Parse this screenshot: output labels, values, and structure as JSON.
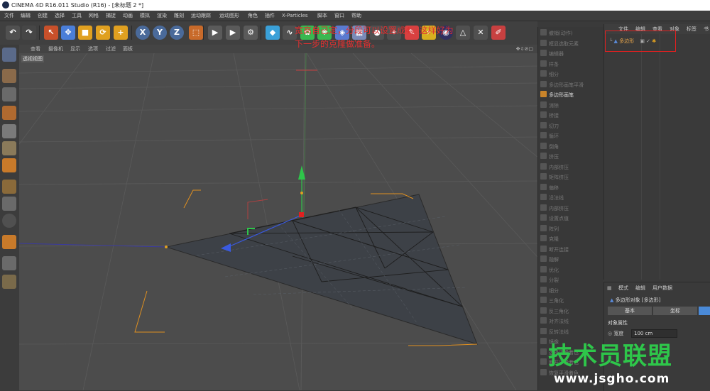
{
  "window": {
    "title": "CINEMA 4D R16.011 Studio (R16) - [未标题 2 *]"
  },
  "menu": [
    "文件",
    "编辑",
    "创建",
    "选择",
    "工具",
    "网格",
    "捕捉",
    "动画",
    "模拟",
    "渲染",
    "雕刻",
    "运动跟踪",
    "运动图形",
    "角色",
    "插件",
    "X-Particles",
    "脚本",
    "窗口",
    "帮助"
  ],
  "toolbar": {
    "items": [
      {
        "icon": "undo-icon",
        "glyph": "↶",
        "color": "#505050"
      },
      {
        "icon": "redo-icon",
        "glyph": "↷",
        "color": "#464646"
      },
      {
        "icon": "select-arrow-icon",
        "glyph": "↖",
        "color": "#c8502a"
      },
      {
        "icon": "move-icon",
        "glyph": "✥",
        "color": "#4a7ed8"
      },
      {
        "icon": "scale-icon",
        "glyph": "■",
        "color": "#e0a020"
      },
      {
        "icon": "rotate-icon",
        "glyph": "⟳",
        "color": "#e0a020"
      },
      {
        "icon": "add-icon",
        "glyph": "+",
        "color": "#e0a020"
      },
      {
        "icon": "x-axis-icon",
        "glyph": "X",
        "color": "#4a6a9a"
      },
      {
        "icon": "y-axis-icon",
        "glyph": "Y",
        "color": "#4a6a9a"
      },
      {
        "icon": "z-axis-icon",
        "glyph": "Z",
        "color": "#4a6a9a"
      },
      {
        "icon": "coord-system-icon",
        "glyph": "⬚",
        "color": "#c86a2a"
      },
      {
        "icon": "render-view-icon",
        "glyph": "▶",
        "color": "#5a5a5a"
      },
      {
        "icon": "render-to-picture-viewer-icon",
        "glyph": "▶",
        "color": "#5a5a5a"
      },
      {
        "icon": "render-settings-icon",
        "glyph": "⚙",
        "color": "#5a5a5a"
      },
      {
        "icon": "cube-icon",
        "glyph": "◆",
        "color": "#3aa0d8"
      },
      {
        "icon": "spline-pen-icon",
        "glyph": "∿",
        "color": "#505050"
      },
      {
        "icon": "subdivision-icon",
        "glyph": "✿",
        "color": "#3ab850"
      },
      {
        "icon": "array-icon",
        "glyph": "❋",
        "color": "#3ab850"
      },
      {
        "icon": "deformer-icon",
        "glyph": "◈",
        "color": "#5a7ad0"
      },
      {
        "icon": "floor-icon",
        "glyph": "▦",
        "color": "#7a8ab8"
      },
      {
        "icon": "camera-icon",
        "glyph": "●",
        "color": "#505050"
      },
      {
        "icon": "light-icon",
        "glyph": "✦",
        "color": "#505050"
      },
      {
        "icon": "material-editor-icon",
        "glyph": "✎",
        "color": "#d84040"
      },
      {
        "icon": "xparticles-emitter-icon",
        "glyph": "⚡",
        "color": "#d8b020"
      },
      {
        "icon": "sphere-icon",
        "glyph": "◉",
        "color": "#303060"
      },
      {
        "icon": "lightbulb-icon",
        "glyph": "△",
        "color": "#505050"
      },
      {
        "icon": "wrench-icon",
        "glyph": "✕",
        "color": "#505050"
      },
      {
        "icon": "paint-icon",
        "glyph": "✐",
        "color": "#c84040"
      }
    ]
  },
  "viewport": {
    "menu": [
      "查看",
      "摄像机",
      "显示",
      "选项",
      "过滤",
      "面板"
    ],
    "label": "透视视图"
  },
  "annotation": {
    "line1": "宽高自己定，分段可以设置成4，这样好为",
    "line2": "下一步的克隆做准备。"
  },
  "attr_tools": {
    "items": [
      {
        "label": "撤销(动作)",
        "active": false
      },
      {
        "label": "框显选取元素",
        "active": false
      },
      {
        "label": "编辑器",
        "active": false
      },
      {
        "label": "样条",
        "active": false
      },
      {
        "label": "细分",
        "active": false
      },
      {
        "label": "多边形画笔平滑",
        "active": false
      },
      {
        "label": "多边形画笔",
        "active": true
      },
      {
        "label": "消除",
        "active": false
      },
      {
        "label": "桥接",
        "active": false
      },
      {
        "label": "切刀",
        "active": false
      },
      {
        "label": "循环",
        "active": false
      },
      {
        "label": "倒角",
        "active": false
      },
      {
        "label": "挤压",
        "active": false
      },
      {
        "label": "内部挤压",
        "active": false
      },
      {
        "label": "矩阵挤压",
        "active": false
      },
      {
        "label": "偏移",
        "active": false
      },
      {
        "label": "沿法线",
        "active": false
      },
      {
        "label": "内部挤压",
        "active": false
      },
      {
        "label": "设置点值",
        "active": false
      },
      {
        "label": "阵列",
        "active": false
      },
      {
        "label": "克隆",
        "active": false
      },
      {
        "label": "断开连接",
        "active": false
      },
      {
        "label": "融解",
        "active": false
      },
      {
        "label": "优化",
        "active": false
      },
      {
        "label": "分裂",
        "active": false
      },
      {
        "label": "细分",
        "active": false
      },
      {
        "label": "三角化",
        "active": false
      },
      {
        "label": "反三角化",
        "active": false
      },
      {
        "label": "对齐法线",
        "active": false
      },
      {
        "label": "反转法线",
        "active": false
      },
      {
        "label": "镜像",
        "active": false
      },
      {
        "label": "选择平滑着色",
        "active": false
      },
      {
        "label": "断开平滑着色",
        "active": false
      },
      {
        "label": "恢复平滑着色",
        "active": false
      }
    ]
  },
  "object_manager": {
    "menu": [
      "文件",
      "编辑",
      "查看",
      "对象",
      "标签",
      "书"
    ],
    "object_name": "多边形"
  },
  "attribute_manager": {
    "menu": [
      "模式",
      "编辑",
      "用户数据"
    ],
    "title": "多边形对象 [多边形]",
    "tabs": [
      "基本",
      "坐标",
      ""
    ],
    "section": "对象属性",
    "width_label": "宽度",
    "width_value": "100 cm"
  },
  "watermark": {
    "text": "技术员联盟",
    "url": "www.jsgho.com"
  }
}
